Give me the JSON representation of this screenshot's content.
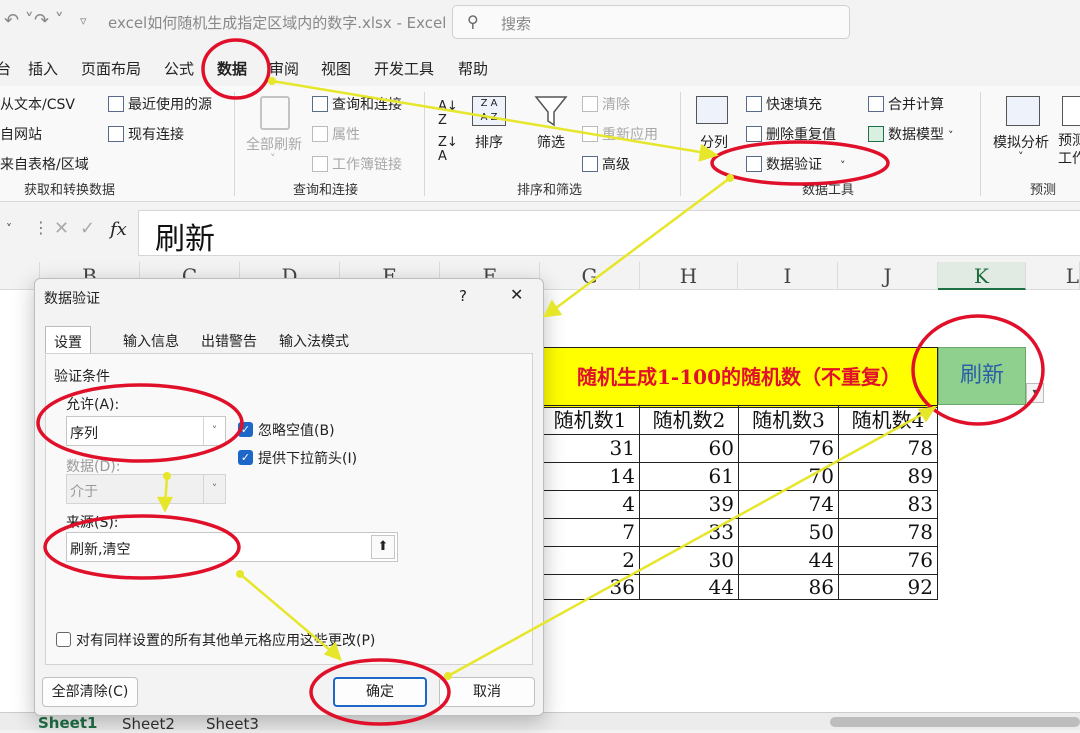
{
  "window": {
    "title": "excel如何随机生成指定区域内的数字.xlsx  -  Excel",
    "search_placeholder": "搜索"
  },
  "menu": {
    "tabs": [
      "台",
      "插入",
      "页面布局",
      "公式",
      "数据",
      "审阅",
      "视图",
      "开发工具",
      "帮助"
    ],
    "active": "数据"
  },
  "ribbon": {
    "get_data": {
      "items": [
        "从文本/CSV",
        "自网站",
        "来自表格/区域",
        "最近使用的源",
        "现有连接"
      ],
      "group": "获取和转换数据"
    },
    "queries": {
      "refresh_all": "全部刷新",
      "items": [
        "查询和连接",
        "属性",
        "工作簿链接"
      ],
      "group": "查询和连接"
    },
    "sort_filter": {
      "sort": "排序",
      "filter": "筛选",
      "items": [
        "清除",
        "重新应用",
        "高级"
      ],
      "group": "排序和筛选"
    },
    "data_tools": {
      "split": "分列",
      "items": [
        "快速填充",
        "删除重复值",
        "数据验证",
        "合并计算",
        "数据模型"
      ],
      "group": "数据工具"
    },
    "forecast": {
      "whatif": "模拟分析",
      "forecast_sheet": "预测\n工作",
      "group": "预测"
    }
  },
  "formula_bar": {
    "name_box": "",
    "fx": "fx",
    "value": "刷新"
  },
  "sheet": {
    "columns": [
      "B",
      "C",
      "D",
      "E",
      "F",
      "G",
      "H",
      "I",
      "J",
      "K",
      "L"
    ],
    "selected_column": "K",
    "title": "随机生成1-100的随机数（不重复）",
    "headers": [
      "随机数1",
      "随机数2",
      "随机数3",
      "随机数4"
    ],
    "rows": [
      [
        31,
        60,
        76,
        78
      ],
      [
        14,
        61,
        70,
        89
      ],
      [
        4,
        39,
        74,
        83
      ],
      [
        7,
        33,
        50,
        78
      ],
      [
        2,
        30,
        44,
        76
      ],
      [
        36,
        44,
        86,
        92
      ]
    ],
    "refresh_cell": "刷新",
    "sheet_tabs": [
      "Sheet1",
      "Sheet2",
      "Sheet3"
    ]
  },
  "dialog": {
    "title": "数据验证",
    "help": "?",
    "close": "✕",
    "tabs": [
      "设置",
      "输入信息",
      "出错警告",
      "输入法模式"
    ],
    "section": "验证条件",
    "allow_label": "允许(A):",
    "allow_value": "序列",
    "ignore_blank": "忽略空值(B)",
    "dropdown_arrow": "提供下拉箭头(I)",
    "data_label": "数据(D):",
    "data_value": "介于",
    "source_label": "来源(S):",
    "source_value": "刷新,清空",
    "apply_all": "对有同样设置的所有其他单元格应用这些更改(P)",
    "clear_all": "全部清除(C)",
    "ok": "确定",
    "cancel": "取消"
  },
  "colors": {
    "accent": "#1c67c7",
    "annotation_red": "#e0102a",
    "annotation_arrow": "#e6e62a",
    "title_fill": "#ffff00",
    "title_text": "#e0102a",
    "refresh_fill": "#8fd08f"
  }
}
